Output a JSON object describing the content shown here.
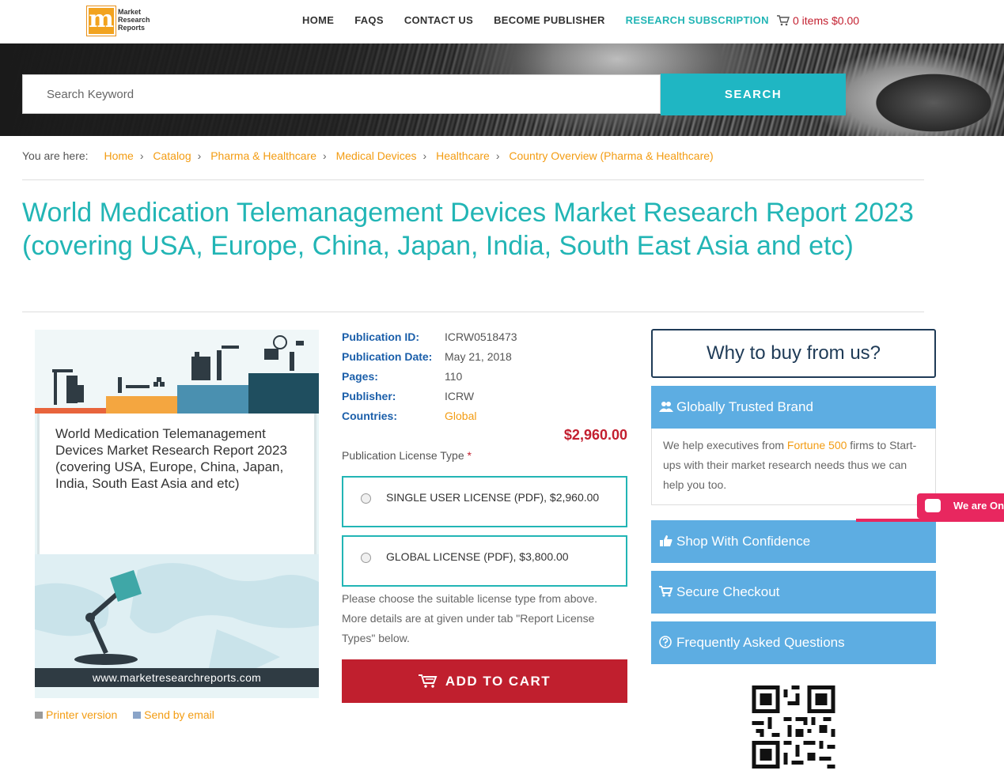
{
  "header": {
    "logo_text": "Market Research Reports",
    "logo_letter": "m",
    "nav": [
      {
        "label": "HOME"
      },
      {
        "label": "FAQS"
      },
      {
        "label": "CONTACT US"
      },
      {
        "label": "BECOME PUBLISHER"
      },
      {
        "label": "RESEARCH SUBSCRIPTION"
      }
    ],
    "cart": "0 items $0.00",
    "cart_icon": "shopping-cart-icon"
  },
  "search": {
    "placeholder": "Search Keyword",
    "button": "SEARCH"
  },
  "breadcrumb": {
    "prefix": "You are here:",
    "items": [
      "Home",
      "Catalog",
      "Pharma & Healthcare",
      "Medical Devices",
      "Healthcare",
      "Country Overview (Pharma & Healthcare)"
    ]
  },
  "page_title": "World Medication Telemanagement Devices Market Research Report 2023 (covering USA, Europe, China, Japan, India, South East Asia and etc)",
  "cover": {
    "title": "World Medication Telemanagement Devices Market Research Report 2023 (covering USA, Europe, China, Japan, India, South East Asia and etc)",
    "url": "www.marketresearchreports.com"
  },
  "links": {
    "printer": "Printer version",
    "email": "Send by email"
  },
  "details": {
    "rows": [
      {
        "label": "Publication ID:",
        "value": "ICRW0518473"
      },
      {
        "label": "Publication Date:",
        "value": "May 21, 2018"
      },
      {
        "label": "Pages:",
        "value": "110"
      },
      {
        "label": "Publisher:",
        "value": "ICRW"
      },
      {
        "label": "Countries:",
        "value": "Global"
      }
    ],
    "price": "$2,960.00",
    "license_label": "Publication License Type",
    "required_mark": "*",
    "licenses": [
      {
        "label": "SINGLE USER LICENSE (PDF), $2,960.00"
      },
      {
        "label": "GLOBAL LICENSE (PDF), $3,800.00"
      }
    ],
    "help": "Please choose the suitable license type from above. More details are at given under tab \"Report License Types\" below.",
    "add_to_cart": "ADD TO CART"
  },
  "sidebar": {
    "why": "Why to buy from us?",
    "trusted": {
      "title": "Globally Trusted Brand",
      "icon": "users-icon",
      "text_before": "We help executives from ",
      "highlight": "Fortune 500",
      "text_after": " firms to Start-ups with their market research needs thus we can help you too."
    },
    "items": [
      {
        "title": "Shop With Confidence",
        "icon": "thumbs-up-icon"
      },
      {
        "title": "Secure Checkout",
        "icon": "cart-icon"
      },
      {
        "title": "Frequently Asked Questions",
        "icon": "question-circle-icon"
      }
    ],
    "chat": "We are Online"
  },
  "colors": {
    "teal": "#22b5b5",
    "orange": "#f39c12",
    "red": "#c01f2e",
    "navy": "#1b5faa",
    "sidebar_blue": "#5dade2",
    "chat_pink": "#e8275f"
  }
}
